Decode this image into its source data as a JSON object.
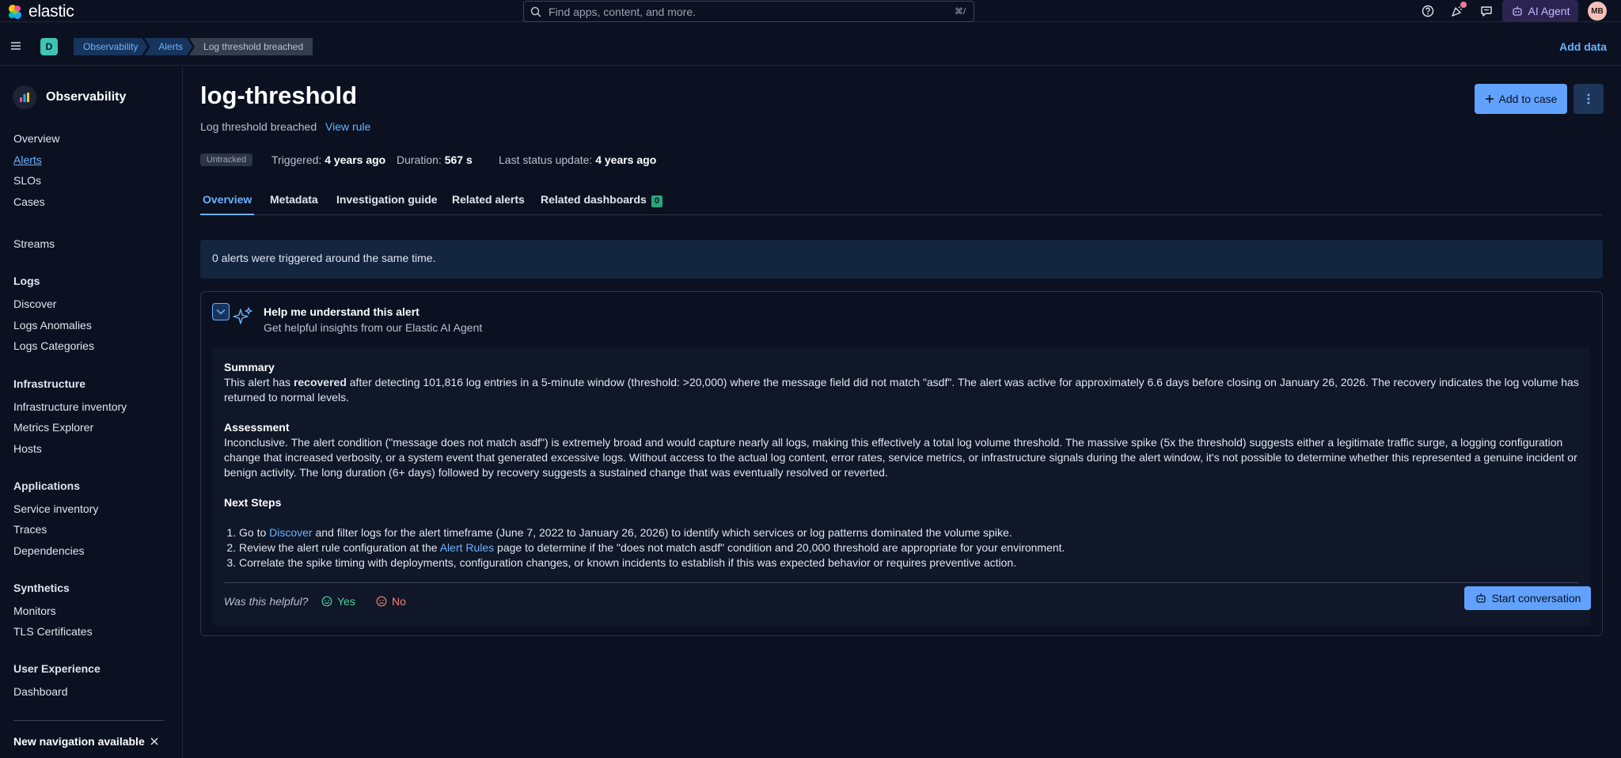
{
  "header": {
    "logo_text": "elastic",
    "search_placeholder": "Find apps, content, and more.",
    "search_shortcut": "⌘/",
    "ai_agent_label": "AI Agent",
    "avatar_initials": "MB"
  },
  "subbar": {
    "space_initial": "D",
    "breadcrumbs": [
      "Observability",
      "Alerts",
      "Log threshold breached"
    ],
    "add_data_label": "Add data"
  },
  "sidebar": {
    "title": "Observability",
    "items": [
      {
        "label": "Overview"
      },
      {
        "label": "Alerts"
      },
      {
        "label": "SLOs"
      },
      {
        "label": "Cases"
      },
      {
        "label": "Streams"
      }
    ],
    "groups": [
      {
        "title": "Logs",
        "items": [
          "Discover",
          "Logs Anomalies",
          "Logs Categories"
        ]
      },
      {
        "title": "Infrastructure",
        "items": [
          "Infrastructure inventory",
          "Metrics Explorer",
          "Hosts"
        ]
      },
      {
        "title": "Applications",
        "items": [
          "Service inventory",
          "Traces",
          "Dependencies"
        ]
      },
      {
        "title": "Synthetics",
        "items": [
          "Monitors",
          "TLS Certificates"
        ]
      },
      {
        "title": "User Experience",
        "items": [
          "Dashboard"
        ]
      }
    ],
    "new_nav_label": "New navigation available"
  },
  "page": {
    "title": "log-threshold",
    "subtitle": "Log threshold breached",
    "view_rule_label": "View rule",
    "add_to_case_label": "Add to case",
    "status": "Untracked",
    "triggered_label": "Triggered:",
    "triggered_value": "4 years ago",
    "duration_label": "Duration:",
    "duration_value": "567 s",
    "last_status_label": "Last status update:",
    "last_status_value": "4 years ago"
  },
  "tabs": [
    {
      "label": "Overview"
    },
    {
      "label": "Metadata"
    },
    {
      "label": "Investigation guide"
    },
    {
      "label": "Related alerts"
    },
    {
      "label": "Related dashboards",
      "count": "0"
    }
  ],
  "callout": "0 alerts were triggered around the same time.",
  "ai": {
    "heading": "Help me understand this alert",
    "subheading": "Get helpful insights from our Elastic AI Agent",
    "summary_title": "Summary",
    "summary_pre": "This alert has ",
    "summary_bold": "recovered",
    "summary_post": " after detecting 101,816 log entries in a 5-minute window (threshold: >20,000) where the message field did not match \"asdf\". The alert was active for approximately 6.6 days before closing on January 26, 2026. The recovery indicates the log volume has returned to normal levels.",
    "assessment_title": "Assessment",
    "assessment_text": "Inconclusive. The alert condition (\"message does not match asdf\") is extremely broad and would capture nearly all logs, making this effectively a total log volume threshold. The massive spike (5x the threshold) suggests either a legitimate traffic surge, a logging configuration change that increased verbosity, or a system event that generated excessive logs. Without access to the actual log content, error rates, service metrics, or infrastructure signals during the alert window, it's not possible to determine whether this represented a genuine incident or benign activity. The long duration (6+ days) followed by recovery suggests a sustained change that was eventually resolved or reverted.",
    "next_steps_title": "Next Steps",
    "step1_pre": "Go to ",
    "step1_link": "Discover",
    "step1_post": " and filter logs for the alert timeframe (June 7, 2022 to January 26, 2026) to identify which services or log patterns dominated the volume spike.",
    "step2_pre": "Review the alert rule configuration at the ",
    "step2_link": "Alert Rules",
    "step2_post": " page to determine if the \"does not match asdf\" condition and 20,000 threshold are appropriate for your environment.",
    "step3": "Correlate the spike timing with deployments, configuration changes, or known incidents to establish if this was expected behavior or requires preventive action.",
    "helpful_label": "Was this helpful?",
    "yes_label": "Yes",
    "no_label": "No",
    "start_conversation_label": "Start conversation"
  },
  "colors": {
    "background": "#0b1120",
    "accent": "#61a2ff",
    "link": "#6cb2ff",
    "ai_agent": "#2b2451",
    "success": "#4bd3a0",
    "danger": "#f3826b"
  }
}
